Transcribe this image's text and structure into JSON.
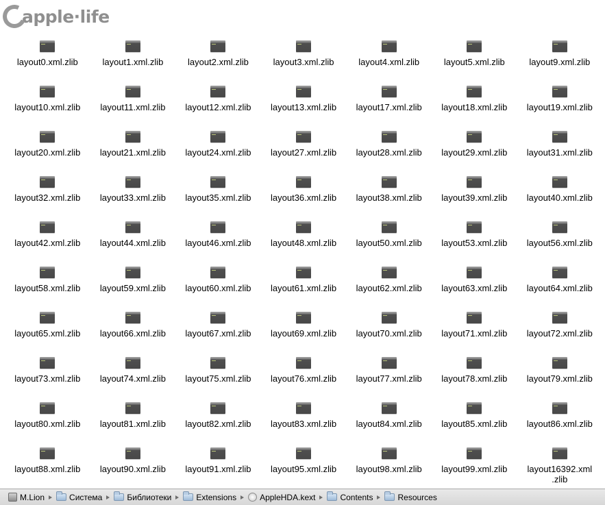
{
  "logo": {
    "text": "apple·life",
    "icon": "apple-life-logo"
  },
  "files": [
    "layout0.xml.zlib",
    "layout1.xml.zlib",
    "layout2.xml.zlib",
    "layout3.xml.zlib",
    "layout4.xml.zlib",
    "layout5.xml.zlib",
    "layout9.xml.zlib",
    "layout10.xml.zlib",
    "layout11.xml.zlib",
    "layout12.xml.zlib",
    "layout13.xml.zlib",
    "layout17.xml.zlib",
    "layout18.xml.zlib",
    "layout19.xml.zlib",
    "layout20.xml.zlib",
    "layout21.xml.zlib",
    "layout24.xml.zlib",
    "layout27.xml.zlib",
    "layout28.xml.zlib",
    "layout29.xml.zlib",
    "layout31.xml.zlib",
    "layout32.xml.zlib",
    "layout33.xml.zlib",
    "layout35.xml.zlib",
    "layout36.xml.zlib",
    "layout38.xml.zlib",
    "layout39.xml.zlib",
    "layout40.xml.zlib",
    "layout42.xml.zlib",
    "layout44.xml.zlib",
    "layout46.xml.zlib",
    "layout48.xml.zlib",
    "layout50.xml.zlib",
    "layout53.xml.zlib",
    "layout56.xml.zlib",
    "layout58.xml.zlib",
    "layout59.xml.zlib",
    "layout60.xml.zlib",
    "layout61.xml.zlib",
    "layout62.xml.zlib",
    "layout63.xml.zlib",
    "layout64.xml.zlib",
    "layout65.xml.zlib",
    "layout66.xml.zlib",
    "layout67.xml.zlib",
    "layout69.xml.zlib",
    "layout70.xml.zlib",
    "layout71.xml.zlib",
    "layout72.xml.zlib",
    "layout73.xml.zlib",
    "layout74.xml.zlib",
    "layout75.xml.zlib",
    "layout76.xml.zlib",
    "layout77.xml.zlib",
    "layout78.xml.zlib",
    "layout79.xml.zlib",
    "layout80.xml.zlib",
    "layout81.xml.zlib",
    "layout82.xml.zlib",
    "layout83.xml.zlib",
    "layout84.xml.zlib",
    "layout85.xml.zlib",
    "layout86.xml.zlib",
    "layout88.xml.zlib",
    "layout90.xml.zlib",
    "layout91.xml.zlib",
    "layout95.xml.zlib",
    "layout98.xml.zlib",
    "layout99.xml.zlib",
    "layout16392.xml\n.zlib"
  ],
  "file_icon": "zlib-file-icon",
  "pathbar": [
    {
      "label": "M.Lion",
      "icon": "disk-icon"
    },
    {
      "label": "Система",
      "icon": "folder-icon"
    },
    {
      "label": "Библиотеки",
      "icon": "folder-icon"
    },
    {
      "label": "Extensions",
      "icon": "folder-icon"
    },
    {
      "label": "AppleHDA.kext",
      "icon": "kext-icon"
    },
    {
      "label": "Contents",
      "icon": "folder-icon"
    },
    {
      "label": "Resources",
      "icon": "folder-icon"
    }
  ]
}
